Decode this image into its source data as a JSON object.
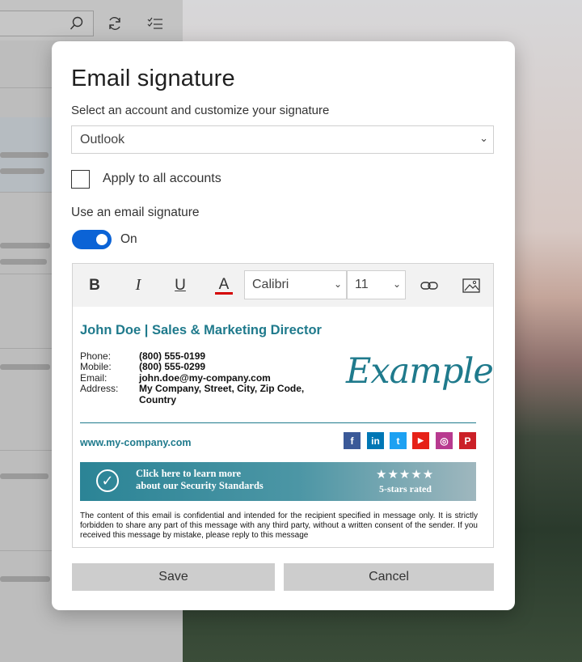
{
  "dialog": {
    "title": "Email signature",
    "subtitle": "Select an account and customize your signature",
    "account_select": "Outlook",
    "apply_all_label": "Apply to all accounts",
    "use_signature_label": "Use an email signature",
    "toggle_label": "On",
    "save_label": "Save",
    "cancel_label": "Cancel"
  },
  "toolbar": {
    "bold": "B",
    "italic": "I",
    "underline": "U",
    "font_color": "A",
    "font": "Calibri",
    "size": "11"
  },
  "signature": {
    "name": "John Doe | Sales & Marketing Director",
    "labels": [
      "Phone:",
      "Mobile:",
      "Email:",
      "Address:"
    ],
    "phone": "(800) 555-0199",
    "mobile": "(800) 555-0299",
    "email": "john.doe@my-company.com",
    "address": "My Company, Street, City, Zip Code, Country",
    "logo": "Example",
    "website": "www.my-company.com",
    "banner_line1": "Click here to learn more",
    "banner_line2": "about our Security Standards",
    "stars": "★★★★★",
    "rated": "5-stars rated",
    "disclaimer": "The content of this email is confidential and intended for the recipient specified in message only. It is strictly forbidden to share any part of this message with any third party, without a written consent of the sender. If you received this message by mistake, please reply to this message"
  },
  "social": [
    {
      "label": "f",
      "color": "#3b5998"
    },
    {
      "label": "in",
      "color": "#0077b5"
    },
    {
      "label": "t",
      "color": "#1da1f2"
    },
    {
      "label": "▶",
      "color": "#e62117"
    },
    {
      "label": "◎",
      "color": "#b83a8f"
    },
    {
      "label": "P",
      "color": "#cb2027"
    }
  ],
  "colors": {
    "accent": "#0b63d6",
    "signature_teal": "#1f7a8c"
  }
}
